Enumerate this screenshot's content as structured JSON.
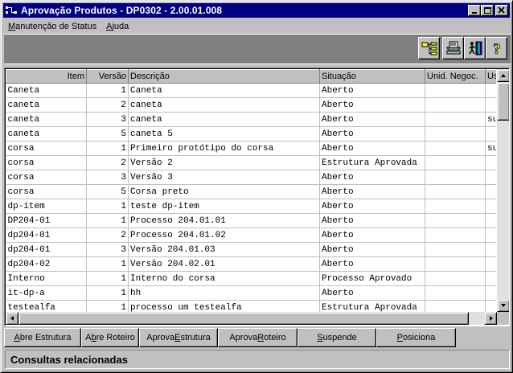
{
  "window": {
    "title": "Aprovação Produtos - DP0302 - 2.00.01.008",
    "minimize_glyph": "_",
    "maximize_glyph": "□",
    "close_glyph": "×"
  },
  "menu": {
    "items": [
      {
        "label_pre": "",
        "label_u": "M",
        "label_post": "anutenção de Status"
      },
      {
        "label_pre": "",
        "label_u": "A",
        "label_post": "juda"
      }
    ]
  },
  "toolbar": {
    "icons": [
      "tree-structure-icon",
      "printer-icon",
      "exit-door-icon",
      "help-question-icon"
    ]
  },
  "grid": {
    "columns": [
      "Item",
      "Versão",
      "Descrição",
      "Situação",
      "Unid. Negoc.",
      "Us"
    ],
    "rows": [
      [
        "Caneta",
        "1",
        "Caneta",
        "Aberto",
        "",
        ""
      ],
      [
        "caneta",
        "2",
        "caneta",
        "Aberto",
        "",
        ""
      ],
      [
        "caneta",
        "3",
        "caneta",
        "Aberto",
        "",
        "su"
      ],
      [
        "caneta",
        "5",
        "caneta 5",
        "Aberto",
        "",
        ""
      ],
      [
        "corsa",
        "1",
        "Primeiro protótipo do corsa",
        "Aberto",
        "",
        "su"
      ],
      [
        "corsa",
        "2",
        "Versão 2",
        "Estrutura Aprovada",
        "",
        ""
      ],
      [
        "corsa",
        "3",
        "Versão 3",
        "Aberto",
        "",
        ""
      ],
      [
        "corsa",
        "5",
        "Corsa preto",
        "Aberto",
        "",
        ""
      ],
      [
        "dp-item",
        "1",
        "teste dp-item",
        "Aberto",
        "",
        ""
      ],
      [
        "DP204-01",
        "1",
        "Processo 204.01.01",
        "Aberto",
        "",
        ""
      ],
      [
        "dp204-01",
        "2",
        "Processo 204.01.02",
        "Aberto",
        "",
        ""
      ],
      [
        "dp204-01",
        "3",
        "Versão 204.01.03",
        "Aberto",
        "",
        ""
      ],
      [
        "dp204-02",
        "1",
        "Versão 204.02.01",
        "Aberto",
        "",
        ""
      ],
      [
        "Interno",
        "1",
        "Interno do corsa",
        "Processo Aprovado",
        "",
        ""
      ],
      [
        "it-dp-a",
        "1",
        "hh",
        "Aberto",
        "",
        ""
      ],
      [
        "testealfa",
        "1",
        "processo um testealfa",
        "Estrutura Aprovada",
        "",
        ""
      ]
    ]
  },
  "actions": [
    {
      "pre": "",
      "u": "A",
      "post": "bre Estrutura"
    },
    {
      "pre": "A",
      "u": "b",
      "post": "re Roteiro"
    },
    {
      "pre": "Aprova ",
      "u": "E",
      "post": "strutura"
    },
    {
      "pre": "Aprova ",
      "u": "R",
      "post": "oteiro"
    },
    {
      "pre": "",
      "u": "S",
      "post": "uspende"
    },
    {
      "pre": "",
      "u": "P",
      "post": "osiciona"
    }
  ],
  "status": {
    "text": "Consultas relacionadas"
  },
  "colors": {
    "titlebar": "#000080",
    "face": "#c0c0c0",
    "shadow": "#808080"
  }
}
